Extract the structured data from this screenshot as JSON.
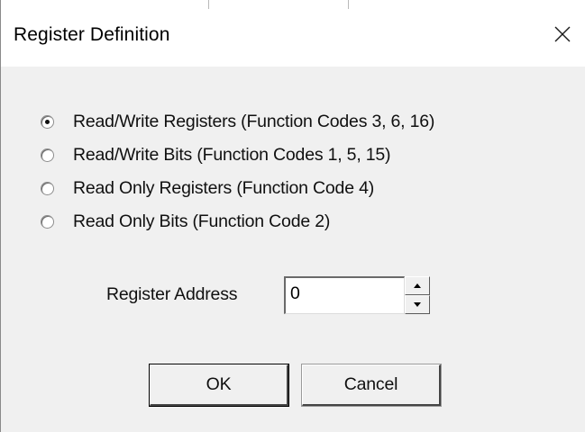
{
  "window": {
    "title": "Register Definition"
  },
  "icons": {
    "close": "close-icon",
    "spin_up": "arrow-up-icon",
    "spin_down": "arrow-down-icon"
  },
  "options": [
    {
      "label": "Read/Write Registers (Function Codes 3, 6, 16)",
      "checked": true
    },
    {
      "label": "Read/Write Bits (Function Codes 1, 5, 15)",
      "checked": false
    },
    {
      "label": "Read Only Registers (Function Code 4)",
      "checked": false
    },
    {
      "label": "Read Only Bits (Function Code 2)",
      "checked": false
    }
  ],
  "register_address": {
    "label": "Register Address",
    "value": "0"
  },
  "buttons": {
    "ok": "OK",
    "cancel": "Cancel"
  }
}
